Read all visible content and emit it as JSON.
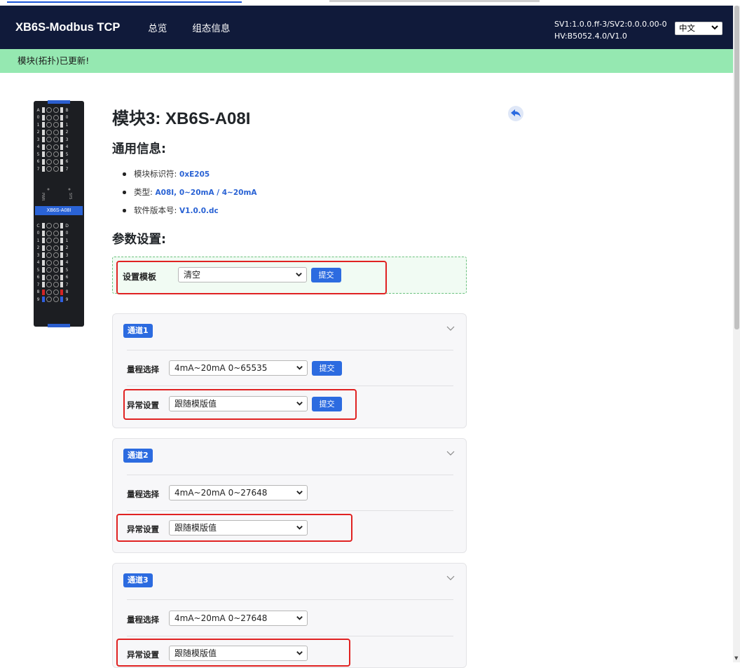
{
  "navbar": {
    "brand": "XB6S-Modbus TCP",
    "links": [
      "总览",
      "组态信息"
    ],
    "version_line1": "SV1:1.0.0.ff-3/SV2:0.0.0.00-0",
    "version_line2": "HV:B5052.4.0/V1.0",
    "language": "中文"
  },
  "alert": {
    "message": "模块(拓扑)已更新!"
  },
  "module": {
    "title": "模块3: XB6S-A08I",
    "device_tag": "XB6S-A08I",
    "device_labels_top_left": [
      "A",
      "0",
      "1",
      "2",
      "3",
      "4",
      "5",
      "6",
      "7"
    ],
    "device_labels_top_right": [
      "B",
      "0",
      "1",
      "2",
      "3",
      "4",
      "5",
      "6",
      "7"
    ],
    "device_labels_bottom_left": [
      "C",
      "0",
      "1",
      "2",
      "3",
      "4",
      "5",
      "6",
      "7",
      "8",
      "9"
    ],
    "device_labels_bottom_right": [
      "D",
      "0",
      "1",
      "2",
      "3",
      "4",
      "5",
      "6",
      "7",
      "8",
      "9"
    ],
    "device_led_left": "PWR",
    "device_led_right": "SYS"
  },
  "general": {
    "heading": "通用信息:",
    "items": [
      {
        "label": "模块标识符: ",
        "value": "0xE205"
      },
      {
        "label": "类型: ",
        "value": "A08I, 0~20mA / 4~20mA"
      },
      {
        "label": "软件版本号: ",
        "value": "V1.0.0.dc"
      }
    ]
  },
  "params": {
    "heading": "参数设置:",
    "template_label": "设置模板",
    "template_value": "清空",
    "submit": "提交"
  },
  "channels": [
    {
      "badge": "通道1",
      "range_label": "量程选择",
      "range_value": "4mA~20mA 0~65535",
      "fault_label": "异常设置",
      "fault_value": "跟随模版值",
      "submit": "提交"
    },
    {
      "badge": "通道2",
      "range_label": "量程选择",
      "range_value": "4mA~20mA 0~27648",
      "fault_label": "异常设置",
      "fault_value": "跟随模版值"
    },
    {
      "badge": "通道3",
      "range_label": "量程选择",
      "range_value": "4mA~20mA 0~27648",
      "fault_label": "异常设置",
      "fault_value": "跟随模版值"
    }
  ],
  "colors": {
    "navbar": "#101a3a",
    "alert": "#95e8b1",
    "primary": "#2c6be0",
    "highlight": "#e02222"
  }
}
